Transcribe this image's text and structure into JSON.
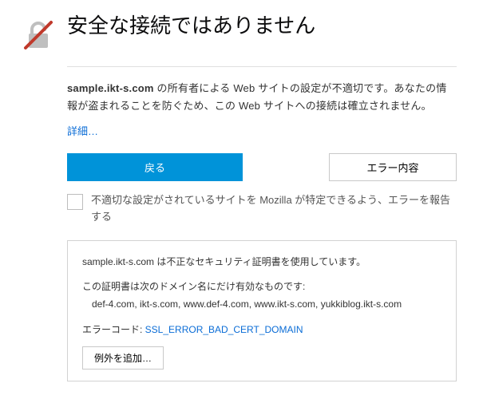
{
  "header": {
    "title": "安全な接続ではありません"
  },
  "description": {
    "domain": "sample.ikt-s.com",
    "text": " の所有者による Web サイトの設定が不適切です。あなたの情報が盗まれることを防ぐため、この Web サイトへの接続は確立されません。"
  },
  "learn_more": "詳細…",
  "buttons": {
    "back": "戻る",
    "error_details": "エラー内容"
  },
  "report": {
    "checkbox_label": "不適切な設定がされているサイトを Mozilla が特定できるよう、エラーを報告する"
  },
  "detail": {
    "cert_line": "sample.ikt-s.com は不正なセキュリティ証明書を使用しています。",
    "valid_for_label": "この証明書は次のドメイン名にだけ有効なものです:",
    "domains": "def-4.com, ikt-s.com, www.def-4.com, www.ikt-s.com, yukkiblog.ikt-s.com",
    "error_code_label": "エラーコード: ",
    "error_code": "SSL_ERROR_BAD_CERT_DOMAIN",
    "add_exception": "例外を追加…"
  }
}
